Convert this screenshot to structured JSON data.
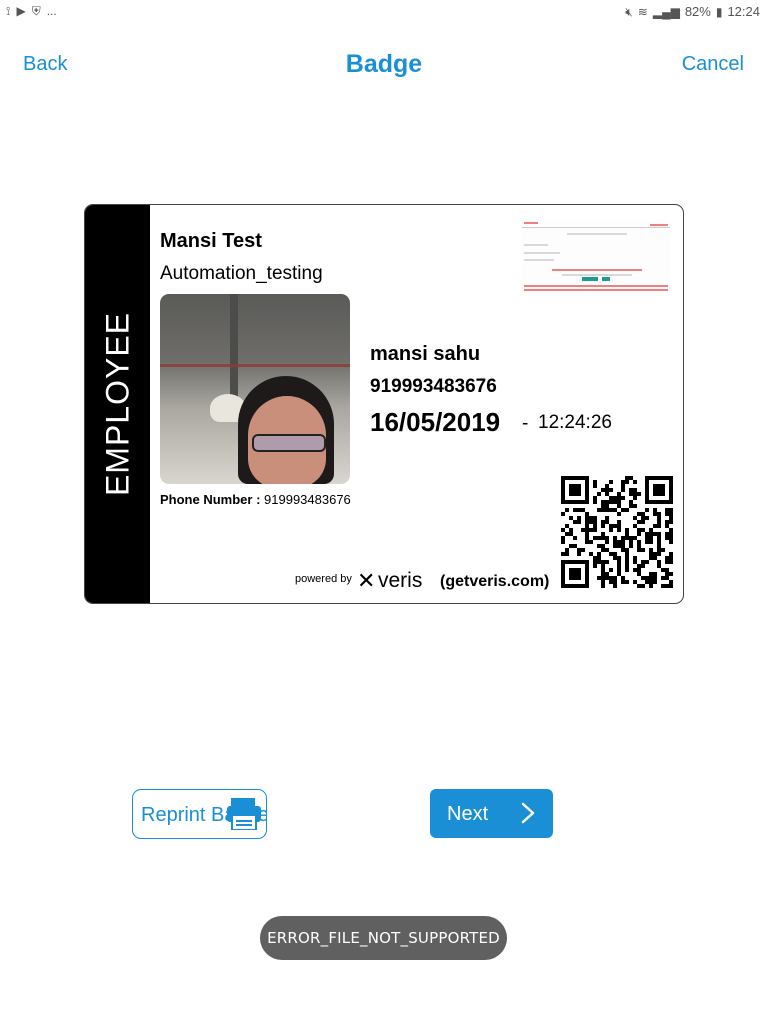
{
  "status_bar": {
    "left_icons": [
      "cast-icon",
      "play-store-icon",
      "shield-icon"
    ],
    "left_more": "...",
    "right_icons": [
      "mute-icon",
      "wifi-icon",
      "signal-icon"
    ],
    "battery": "82%",
    "time": "12:24"
  },
  "header": {
    "back_label": "Back",
    "title": "Badge",
    "cancel_label": "Cancel"
  },
  "badge": {
    "category": "EMPLOYEE",
    "host_name": "Mansi Test",
    "host_department": "Automation_testing",
    "phone_label": "Phone Number :",
    "phone_value": "919993483676",
    "visitor_name": "mansi sahu",
    "visitor_phone": "919993483676",
    "date": "16/05/2019",
    "separator": "-",
    "time": "12:24:26",
    "powered_by": "powered by",
    "brand": "veris",
    "website": "(getveris.com)"
  },
  "actions": {
    "reprint_label": "Reprint Badge",
    "next_label": "Next"
  },
  "toast": {
    "message": "ERROR_FILE_NOT_SUPPORTED"
  },
  "colors": {
    "accent": "#1a8fd6",
    "toast_bg": "#606060",
    "badge_strip": "#000000"
  }
}
